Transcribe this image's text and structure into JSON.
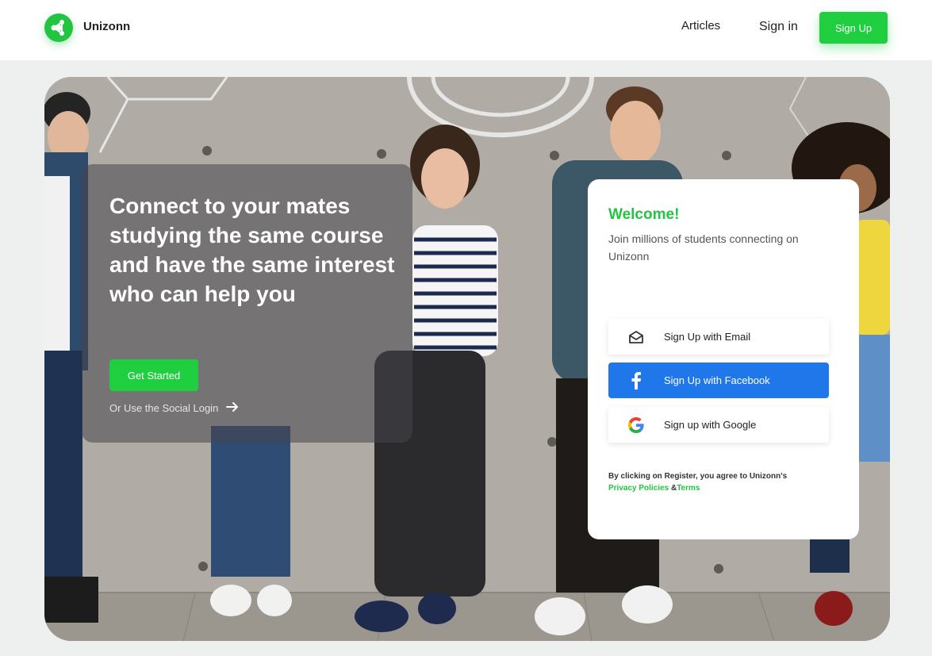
{
  "header": {
    "brand": "Unizonn",
    "nav": {
      "articles": "Articles",
      "sign_in": "Sign in",
      "sign_up": "Sign Up"
    }
  },
  "hero": {
    "headline": "Connect to your mates studying the same course and have the same interest who can help you",
    "get_started": "Get Started",
    "social_login": "Or Use the Social Login"
  },
  "signup": {
    "title": "Welcome!",
    "subtitle": "Join millions of students connecting on Unizonn",
    "email": "Sign Up with Email",
    "facebook": "Sign Up with Facebook",
    "google": "Sign up with Google",
    "terms_prefix": "By clicking on Register, you agree to Unizonn's",
    "privacy": "Privacy Policies",
    "amp": "&",
    "terms": "Terms"
  },
  "colors": {
    "accent": "#22c442",
    "facebook": "#1f77ea"
  },
  "icons": [
    "share-nodes-icon",
    "arrow-right-icon",
    "envelope-icon",
    "facebook-icon",
    "google-icon"
  ]
}
